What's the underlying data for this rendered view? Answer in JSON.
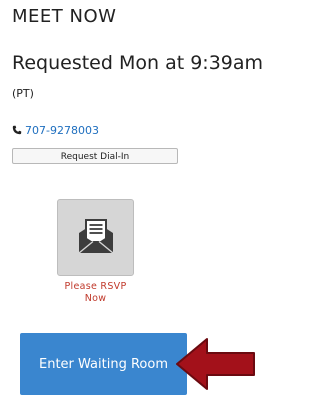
{
  "header": {
    "title": "MEET NOW"
  },
  "request": {
    "text": "Requested Mon at 9:39am",
    "timezone": "(PT)"
  },
  "phone": {
    "icon": "phone-icon",
    "number": "707-9278003"
  },
  "dialin": {
    "label": "Request Dial-In"
  },
  "rsvp": {
    "icon": "envelope-letter-icon",
    "label_line1": "Please RSVP",
    "label_line2": "Now"
  },
  "waiting_room": {
    "label": "Enter Waiting Room"
  },
  "colors": {
    "link": "#1f6fbf",
    "rsvp_text": "#c0392b",
    "primary_button": "#3a86cf",
    "arrow": "#a3111a"
  }
}
